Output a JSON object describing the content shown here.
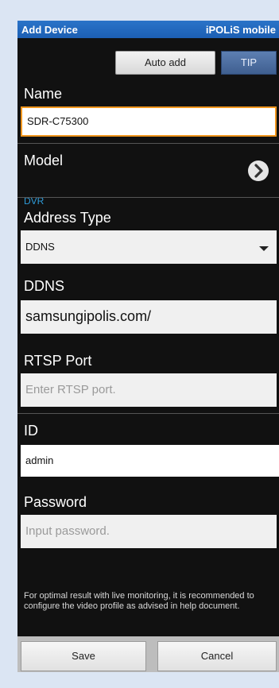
{
  "header": {
    "title": "Add Device",
    "app_name": "iPOLiS mobile"
  },
  "toolbar": {
    "auto_add_label": "Auto add",
    "tip_label": "TIP"
  },
  "form": {
    "name": {
      "label": "Name",
      "value": "SDR-C75300"
    },
    "model": {
      "label": "Model",
      "value": "DVR",
      "icon": "chevron-right-icon"
    },
    "address_type": {
      "label": "Address Type",
      "selected": "DDNS"
    },
    "ddns": {
      "label": "DDNS",
      "value": "samsungipolis.com/"
    },
    "rtsp_port": {
      "label": "RTSP Port",
      "placeholder": "Enter RTSP port."
    },
    "id": {
      "label": "ID",
      "value": "admin"
    },
    "password": {
      "label": "Password",
      "placeholder": "Input password."
    }
  },
  "note": "For optimal result with live monitoring, it is recommended to configure the video profile as advised in help document.",
  "footer": {
    "save_label": "Save",
    "cancel_label": "Cancel"
  },
  "colors": {
    "titlebar": "#1c5fb3",
    "model_value": "#2e9bd8",
    "focus_border": "#f0961e"
  }
}
